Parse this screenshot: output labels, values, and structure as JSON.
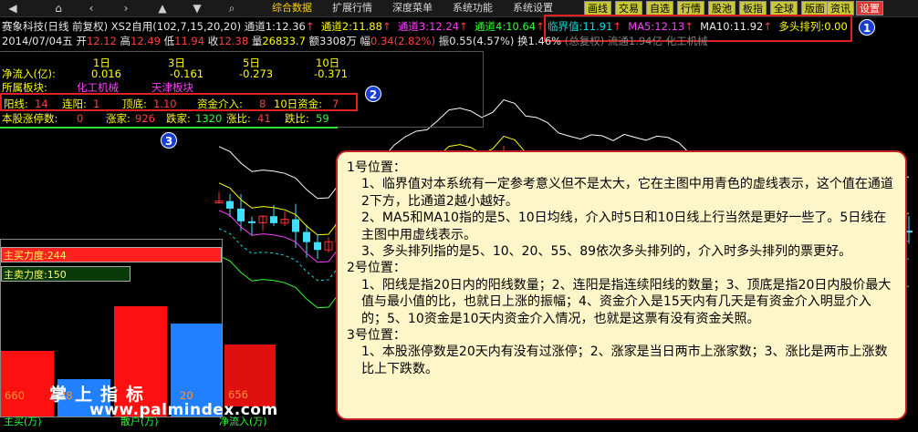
{
  "toolbar": {
    "menus": [
      "综合数据",
      "扩展行情",
      "深度菜单",
      "系统功能",
      "系统设置"
    ],
    "buttons": [
      "画线",
      "交易",
      "自选",
      "行情",
      "股池",
      "板指",
      "全球",
      "版面",
      "资讯",
      "设置"
    ]
  },
  "stock": {
    "name": "赛象科技(日线 前复权)",
    "formula": "XS2自用(102,7,15,20,20)",
    "ch1_label": "通道1:",
    "ch1": "12.36",
    "ch2_label": "通道2:",
    "ch2": "11.88",
    "ch3_label": "通道3:",
    "ch3": "12.24",
    "ch4_label": "通道4:",
    "ch4": "10.64",
    "critical_label": "临界值:",
    "critical": "11.91",
    "ma5_label": "MA5:",
    "ma5": "12.13",
    "ma10_label": "MA10:",
    "ma10": "11.92",
    "bull_label": "多头排列:",
    "bull": "0.00"
  },
  "quote": {
    "date": "2014/07/04五",
    "open_label": "开",
    "open": "12.12",
    "high_label": "高",
    "high": "12.49",
    "low_label": "低",
    "low": "11.94",
    "close_label": "收",
    "close": "12.38",
    "volume_label": "量",
    "volume": "26833.7",
    "amount_label": "额",
    "amount": "3308万",
    "change_label": "幅",
    "change": "0.34(2.82%)",
    "amplitude_label": "振",
    "amplitude": "0.55(4.57%)",
    "turnover_label": "换",
    "turnover": "1.46%",
    "float_text": "(总复权) 流通1.94亿 化工机械"
  },
  "panel": {
    "col_headers": [
      "1日",
      "3日",
      "5日",
      "10日"
    ],
    "netflow_label": "净流入(亿):",
    "netflow": [
      "0.016",
      "-0.161",
      "-0.273",
      "-0.371"
    ],
    "sector_label": "所属板块:",
    "sectors": [
      "化工机械",
      "天津板块"
    ],
    "yang_label": "阳线:",
    "yang": "14",
    "lianyang_label": "连阳:",
    "lianyang": "1",
    "dingdi_label": "顶底:",
    "dingdi": "1.10",
    "fund_label": "资金介入:",
    "fund": "8",
    "fund10_label": "10日资金:",
    "fund10": "7",
    "limit_label": "本股涨停数:",
    "limit": "0",
    "up_label": "涨家:",
    "up": "926",
    "down_label": "跌家:",
    "down": "1320",
    "upratio_label": "涨比:",
    "upratio": "41",
    "downratio_label": "跌比:",
    "downratio": "59"
  },
  "badges": [
    "1",
    "2",
    "3"
  ],
  "bars": {
    "strip1": "主买力度:244",
    "strip2": "主卖力度:150",
    "values": [
      "660",
      "28",
      "20",
      "656"
    ],
    "bottom_labels": [
      "主买(万)",
      "散户(万)",
      "净流入(万)"
    ]
  },
  "watermark": {
    "line1": "掌上指标",
    "line2": "www.palmindex.com"
  },
  "tooltip": {
    "lines": [
      {
        "t": "1号位置：",
        "ind": false
      },
      {
        "t": "1、临界值对本系统有一定参考意义但不是太大，它在主图中用青色的虚线表示，这个值在通道2下方，比通道2越小越好。",
        "ind": true
      },
      {
        "t": "2、MA5和MA10指的是5、10日均线，介入时5日和10日线上行当然是更好一些了。5日线在主图中用虚线表示。",
        "ind": true
      },
      {
        "t": "3、多头排列指的是5、10、20、55、89依次多头排列的，介入时多头排列的票更好。",
        "ind": true
      },
      {
        "t": "2号位置：",
        "ind": false
      },
      {
        "t": "1、阳线是指20日内的阳线数量；2、连阳是指连续阳线的数量；3、顶底是指20日内股价最大值与最小值的比，也就日上涨的振幅；4、资金介入是15天内有几天是有资金介入明显介入的；5、10资金是10天内资金介入情况，也就是这票有没有资金关照。",
        "ind": true
      },
      {
        "t": "3号位置：",
        "ind": false
      },
      {
        "t": "1、本股涨停数是20天内有没有过涨停；2、涨家是当日两市上涨家数；3、涨比是两市上涨数比上下跌数。",
        "ind": true
      }
    ]
  },
  "colors": {
    "bg": "#000000",
    "up": "#ff3030",
    "down": "#40e0ff",
    "tooltip_bg": "#fdf6c8",
    "annot": "#e02020"
  }
}
